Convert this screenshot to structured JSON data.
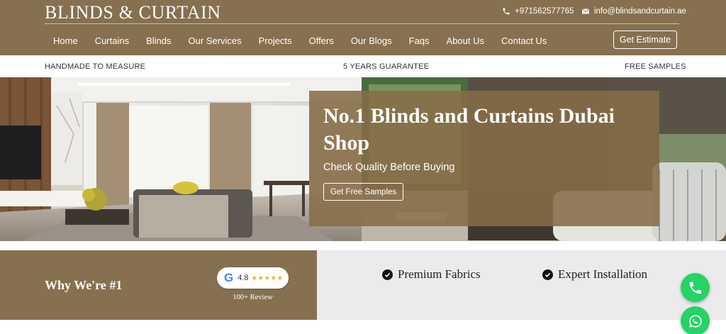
{
  "header": {
    "logo": "BLINDS & CURTAIN",
    "phone": "+971562577765",
    "email": "info@blindsandcurtain.ae",
    "estimate_label": "Get Estimate"
  },
  "nav": [
    "Home",
    "Curtains",
    "Blinds",
    "Our Services",
    "Projects",
    "Offers",
    "Our Blogs",
    "Faqs",
    "About Us",
    "Contact Us"
  ],
  "strip": {
    "left": "HANDMADE TO MEASURE",
    "center": "5 YEARS GUARANTEE",
    "right": "FREE SAMPLES"
  },
  "hero": {
    "title": "No.1 Blinds and Curtains Dubai Shop",
    "subtitle": "Check Quality Before Buying",
    "cta": "Get Free Samples"
  },
  "why": {
    "title": "Why We're #1",
    "google_letter": "G",
    "rating": "4.8",
    "stars": "★★★★★",
    "reviews": "100+ Review"
  },
  "features": [
    "Premium Fabrics",
    "Expert Installation"
  ],
  "icons": {
    "phone": "phone-icon",
    "email": "envelope-icon",
    "check": "check-circle-icon",
    "call": "call-icon",
    "whatsapp": "whatsapp-icon"
  },
  "colors": {
    "brand": "#86704f",
    "features_bg": "#ebebeb",
    "whatsapp": "#25d366",
    "star": "#f5b301"
  }
}
